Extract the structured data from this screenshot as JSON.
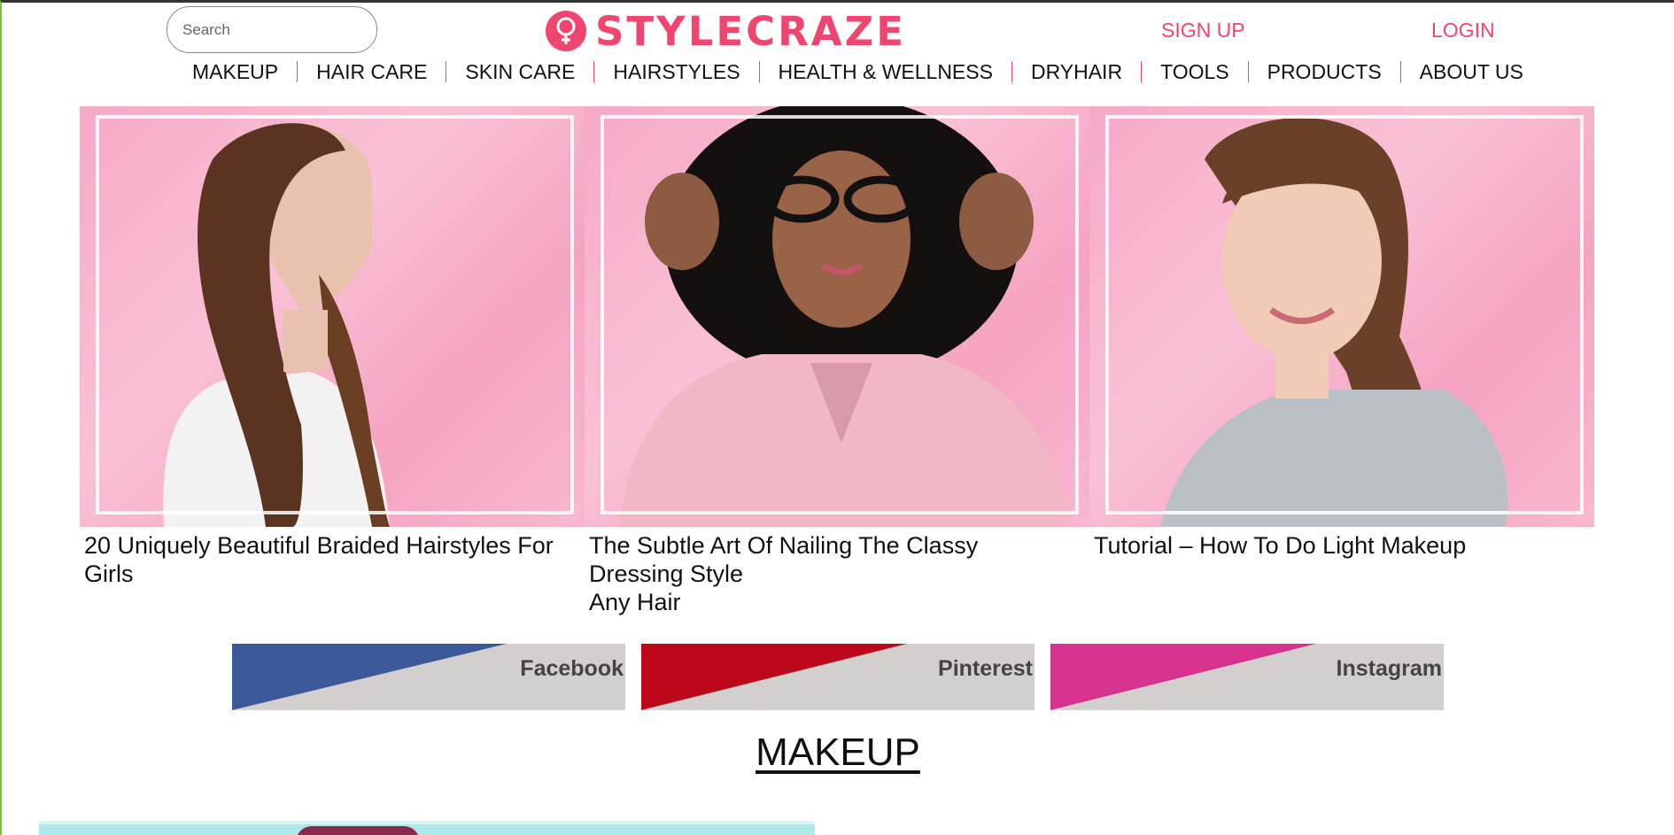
{
  "header": {
    "search_placeholder": "Search",
    "logo_text": "STYLECRAZE",
    "signup_label": "SIGN UP",
    "login_label": "LOGIN",
    "brand_color": "#f0456e"
  },
  "nav": {
    "items": [
      {
        "label": "MAKEUP"
      },
      {
        "label": "HAIR CARE"
      },
      {
        "label": "SKIN CARE"
      },
      {
        "label": "HAIRSTYLES"
      },
      {
        "label": "HEALTH & WELLNESS"
      },
      {
        "label": "DRYHAIR"
      },
      {
        "label": "TOOLS"
      },
      {
        "label": "PRODUCTS"
      },
      {
        "label": "ABOUT US"
      }
    ]
  },
  "featured": [
    {
      "caption": "20 Uniquely Beautiful Braided Hairstyles For Girls",
      "image_icon": "braided-hair-woman-photo"
    },
    {
      "caption": "The Subtle Art Of Nailing The Classy Dressing Style",
      "caption_line2": "Any Hair",
      "image_icon": "woman-glasses-pink-blazer-photo"
    },
    {
      "caption": "Tutorial – How To Do Light Makeup",
      "image_icon": "smiling-woman-makeup-photo"
    }
  ],
  "social": [
    {
      "label": "Facebook",
      "color": "#3b5998"
    },
    {
      "label": "Pinterest",
      "color": "#bd081c"
    },
    {
      "label": "Instagram",
      "color": "#d6338f"
    }
  ],
  "section": {
    "title": "MAKEUP"
  }
}
